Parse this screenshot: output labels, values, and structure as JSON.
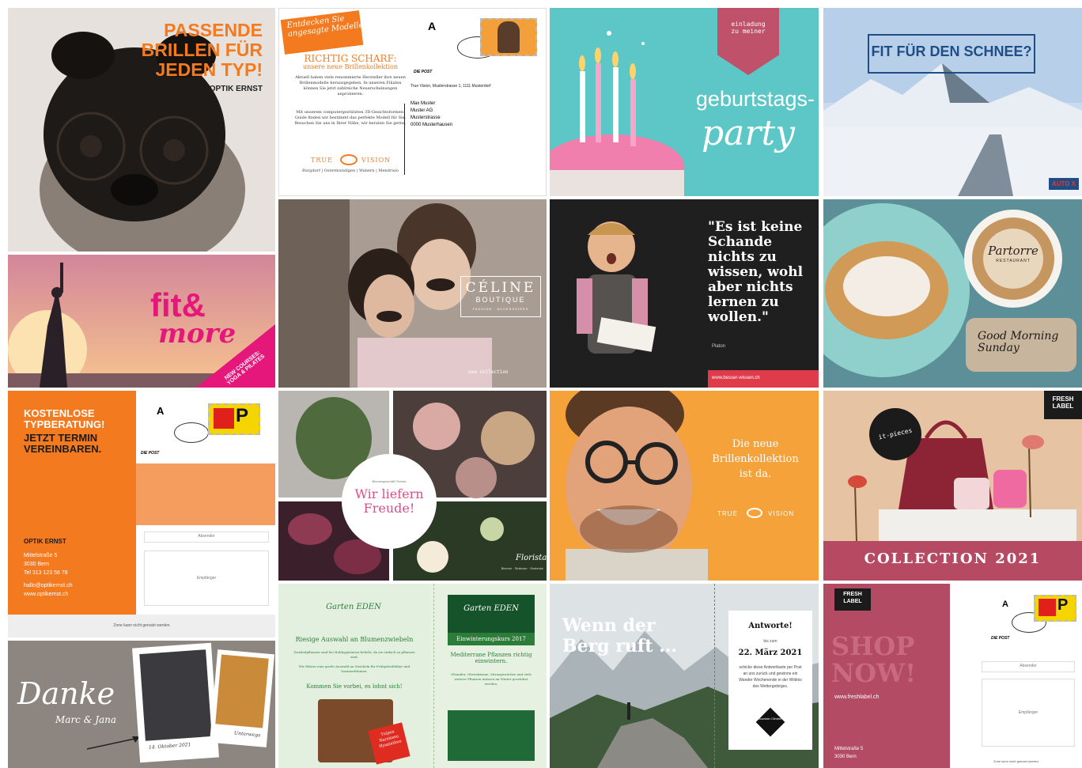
{
  "c1": {
    "headline": "PASSENDE\nBRILLEN FÜR\nJEDEN TYP!",
    "brand": "OPTIK ERNST",
    "accent": "#f47a20"
  },
  "c2": {
    "banner": "Entdecken Sie\nangesagte Modelle",
    "title": "RICHTIG SCHARF:",
    "subtitle": "unsere neue Brillenkollektion",
    "body1": "Aktuell haben viele renommierte Hersteller ihre neuen Brillenmodelle herausgegeben. In unseren Filialen können Sie jetzt zahlreiche Neuerscheinungen anprobieren.",
    "body2": "Mit unserem computergestützten 3D-Gesichtsformen-Guide finden wir bestimmt das perfekte Modell für Sie. Besuchen Sie uns in Ihrer Nähe, wir beraten Sie gerne.",
    "logo_left": "TRUE",
    "logo_right": "VISION",
    "locations": "Burgdorf | Ostermundigen | Wabern | Mendrisio",
    "postage": "A",
    "post_logo": "DIE POST",
    "sender": "True Vision, Musterstrasse 1, 1111 Musterdorf",
    "recipient": [
      "Max Muster",
      "Muster AG",
      "Musterstrasse",
      "0000 Musterhausen"
    ],
    "accent": "#f47a20"
  },
  "c3": {
    "tag": "einladung\nzu meiner",
    "title1": "geburtstags-",
    "title2": "party",
    "bg": "#5cc7c6",
    "tag_color": "#c0516a"
  },
  "c4": {
    "headline": "FIT FÜR DEN SCHNEE?",
    "badge": "AUTO X",
    "title_color": "#1f4e87"
  },
  "c5": {
    "brand1": "fit&",
    "brand2": "more",
    "ribbon": "NEW COURSES:\nYOGA & PILATES",
    "accent": "#e5177b"
  },
  "c6": {
    "brand": "CÉLINE",
    "sub": "BOUTIQUE",
    "tagline": "FASHION · ACCESSOIRES",
    "footer": "new collection"
  },
  "c7": {
    "quote": "\"Es ist keine Schande nichts zu wissen, wohl aber nichts lernen zu wollen.\"",
    "author": "Platon",
    "url": "www.besser-wissen.ch",
    "accent": "#e03b4b"
  },
  "c8": {
    "logo": "Partorre",
    "logo_sub": "RESTAURANT",
    "tag": "Good Morning Sunday"
  },
  "c9": {
    "headline1": "KOSTENLOSE TYPBERATUNG!",
    "headline2": "JETZT TERMIN VEREINBAREN.",
    "brand": "OPTIK ERNST",
    "address": [
      "Mittelstraße 5",
      "3030 Bern",
      "Tel 313 123 56 78"
    ],
    "contact": [
      "hallo@optikernst.ch",
      "www.optikernst.ch"
    ],
    "sender_label": "Absender",
    "recipient_label": "Empfänger",
    "note": "Zone kann nicht genutzt werden",
    "postage": "A",
    "post_logo": "DIE POST",
    "accent": "#f47a20"
  },
  "c10": {
    "small": "Blumengeschäft Florista",
    "big": "Wir liefern\nFreude!",
    "footer_brand": "Florista",
    "footer_sub": "Blumen · Sträusse · Gestecke",
    "accent": "#d94f8e"
  },
  "c11": {
    "line1": "Die neue",
    "line2": "Brillenkollektion",
    "line3": "ist da.",
    "logo_left": "TRUE",
    "logo_right": "VISION",
    "bg": "#f5a23a"
  },
  "c12": {
    "badge": "FRESH\nLABEL",
    "circle": "it-pieces",
    "title": "COLLECTION 2021",
    "bar": "#b64a63"
  },
  "c13": {
    "title": "Danke",
    "names": "Marc & Jana",
    "date": "14. Oktober 2021",
    "caption2": "Unterwegs",
    "bg": "#8d8680"
  },
  "c14": {
    "logo": "Garten EDEN",
    "title": "Riesige Auswahl an Blumenzwiebeln",
    "body1": "Zwiebelpflanzen sind bei Hobbygärtnern beliebt, da sie einfach zu pflanzen sind.",
    "body2": "Wir führen eine große Auswahl an Zwiebeln für Frühjahrsblüher und Sommerblumen.",
    "cta": "Kommen Sie vorbei, es lohnt sich!",
    "label": "Tulpen\nNarzissen\nHyazinthen",
    "right_title": "Einwinterungskurs 2017",
    "right_sub": "Mediterrane Pflanzen richtig einwintern.",
    "right_body": "Oleander, Olivenbäume, Zitrusgewächse und viele weitere Pflanzen müssen im Winter geschützt werden.",
    "green": "#2d7d3a",
    "red": "#e02b20"
  },
  "c15": {
    "headline1": "Wenn der",
    "headline2": "Berg ruft ...",
    "reply": "Antworte!",
    "bis": "bis zum",
    "date": "22. März 2021",
    "body": "schicke diese Antwortkarte per Post an uns zurück und gewinne ein Wander Wochenende in der Wildnis des Wettergebirges.",
    "logo": "Mountain Climbers"
  },
  "c16": {
    "badge": "FRESH\nLABEL",
    "title": "SHOP\nNOW!",
    "url": "www.freshlabel.ch",
    "address": [
      "Mittelstraße 5",
      "3030 Bern"
    ],
    "sender_label": "Absender",
    "recipient_label": "Empfänger",
    "note": "Zone kann nicht genutzt werden",
    "postage": "A",
    "post_logo": "DIE POST",
    "bg": "#b24b63"
  }
}
